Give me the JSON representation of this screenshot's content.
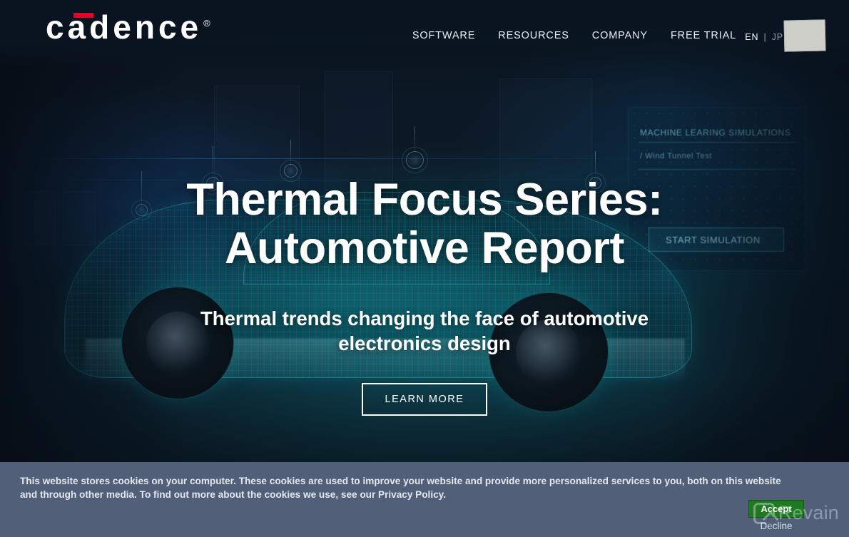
{
  "brand": {
    "logo_text": "cadence",
    "registered_mark": "®",
    "accent_color": "#e4002b"
  },
  "header": {
    "nav_items": [
      {
        "label": "SOFTWARE",
        "name": "nav-software"
      },
      {
        "label": "RESOURCES",
        "name": "nav-resources"
      },
      {
        "label": "COMPANY",
        "name": "nav-company"
      },
      {
        "label": "FREE TRIAL",
        "name": "nav-free-trial"
      }
    ],
    "language": {
      "active": "EN",
      "separator": "|",
      "alternate": "JP"
    },
    "background_color": "#0a1522"
  },
  "hero": {
    "title_line1": "Thermal Focus Series:",
    "title_line2": "Automotive Report",
    "subtitle": "Thermal trends changing the face of automotive electronics design",
    "cta_label": "LEARN MORE",
    "background_texts": [
      "MACHINE LEARING SIMULATIONS",
      "/ Wind Tunnel Test",
      "START SIMULATION"
    ],
    "accent_color": "#1fc0cf"
  },
  "cookie_banner": {
    "message_part1": "This website stores cookies on your computer. These cookies are used to improve your website and provide more personalized services to you, both on this website and through other media. To find out more about the cookies we use, see our ",
    "privacy_link": "Privacy Policy",
    "message_part2": ".",
    "accept_label": "Accept",
    "decline_label": "Decline",
    "background_color": "#515f78",
    "accept_color": "#1f7a1f"
  },
  "watermark": {
    "text": "Revain"
  }
}
